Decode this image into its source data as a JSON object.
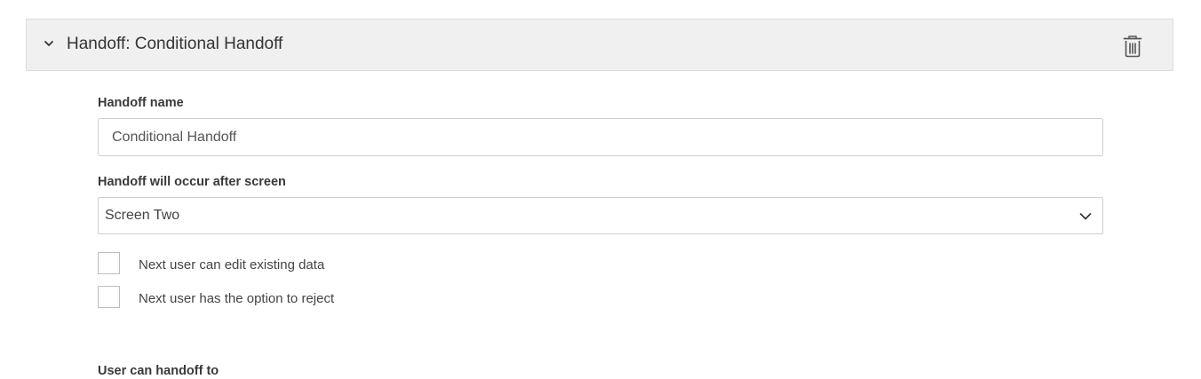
{
  "panel": {
    "title": "Handoff: Conditional Handoff",
    "collapse_icon": "chevron-down-icon",
    "delete_icon": "trash-icon"
  },
  "form": {
    "name_label": "Handoff name",
    "name_value": "Conditional Handoff",
    "screen_label": "Handoff will occur after screen",
    "screen_value": "Screen Two",
    "screen_caret_icon": "chevron-down-icon",
    "options": [
      {
        "label": "Next user can edit existing data",
        "checked": false
      },
      {
        "label": "Next user has the option to reject",
        "checked": false
      }
    ],
    "handoff_to_label": "User can handoff to"
  },
  "colors": {
    "header_bg": "#f0f0f0",
    "border": "#cfcfcf",
    "text": "#333333"
  }
}
